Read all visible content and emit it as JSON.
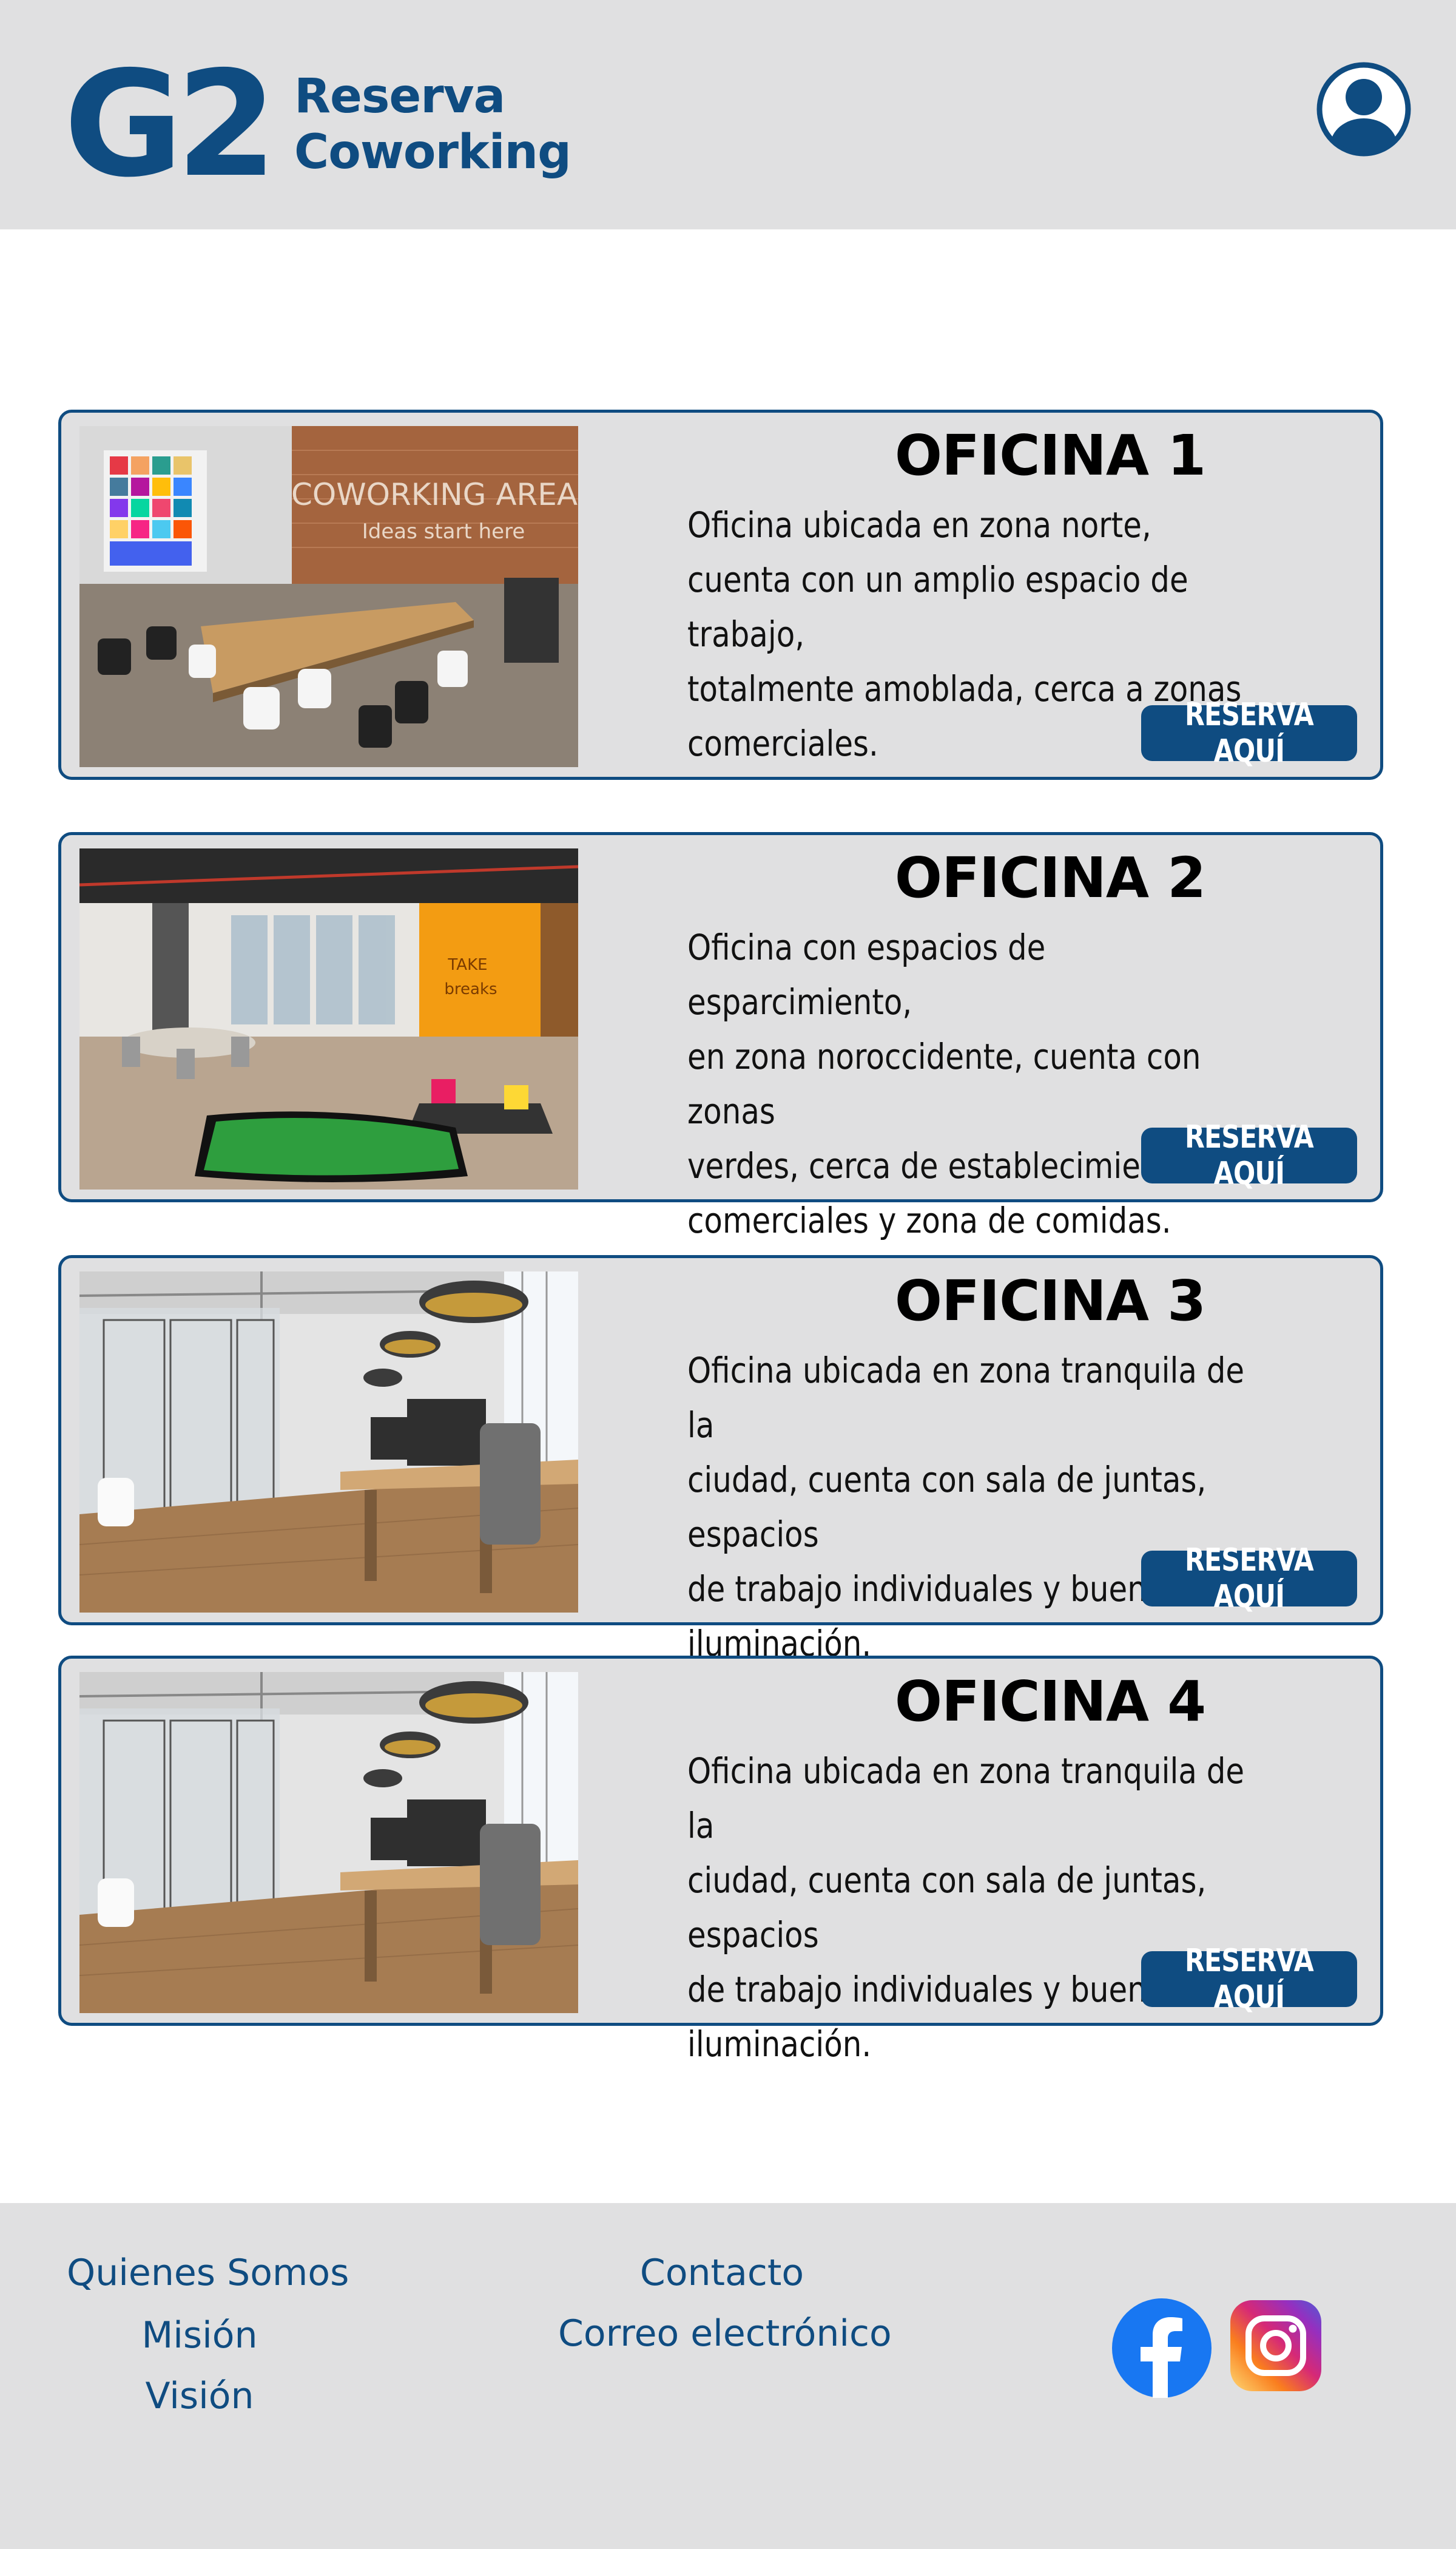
{
  "header": {
    "logo_mark": "G2",
    "logo_line1": "Reserva",
    "logo_line2": "Coworking",
    "avatar_icon": "user-circle-icon"
  },
  "offices": [
    {
      "title": "OFICINA 1",
      "description": "Oficina ubicada en zona norte,\ncuenta con un amplio espacio de trabajo,\ntotalmente amoblada, cerca a zonas\ncomerciales.",
      "button": "RESERVA AQUÍ",
      "photo_text": "COWORKING AREA Ideas start here"
    },
    {
      "title": "OFICINA 2",
      "description": "Oficina con espacios de esparcimiento,\nen zona noroccidente, cuenta con zonas\nverdes, cerca de establecimientos\ncomerciales y zona de comidas.",
      "button": "RESERVA AQUÍ"
    },
    {
      "title": "OFICINA 3",
      "description": "Oficina ubicada en zona tranquila de la\nciudad, cuenta con sala de juntas, espacios\nde trabajo individuales y buena\niluminación.",
      "button": "RESERVA AQUÍ"
    },
    {
      "title": "OFICINA 4",
      "description": "Oficina ubicada en zona tranquila de la\nciudad, cuenta con sala de juntas, espacios\nde trabajo individuales y buena\niluminación.",
      "button": "RESERVA AQUÍ"
    }
  ],
  "footer": {
    "quienes_somos": "Quienes Somos",
    "mision": "Misión",
    "vision": "Visión",
    "contacto": "Contacto",
    "correo": "Correo electrónico",
    "social_icons": [
      "facebook-icon",
      "instagram-icon"
    ]
  },
  "colors": {
    "brand": "#0f4c81",
    "panel": "#e0e0e1",
    "background": "#ffffff"
  }
}
